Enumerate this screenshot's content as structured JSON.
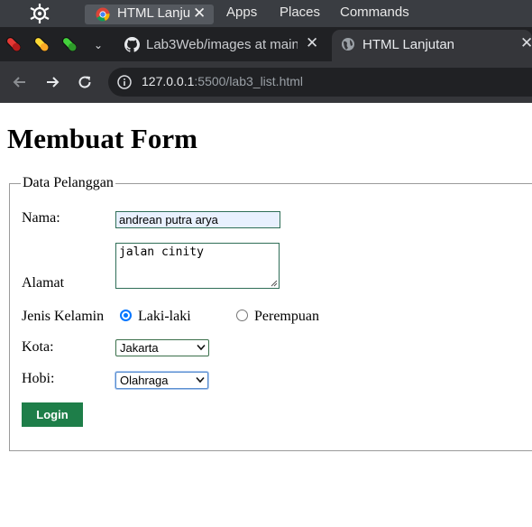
{
  "os_panel": {
    "task_title": "HTML Lanju",
    "menus": [
      "Apps",
      "Places",
      "Commands"
    ]
  },
  "browser": {
    "tabs": [
      {
        "title": "Lab3Web/images at main",
        "icon": "github-icon",
        "active": false
      },
      {
        "title": "HTML Lanjutan",
        "icon": "globe-icon",
        "active": true
      }
    ],
    "url_host": "127.0.0.1",
    "url_rest": ":5500/lab3_list.html"
  },
  "page": {
    "heading": "Membuat Form",
    "fieldset_legend": "Data Pelanggan",
    "form": {
      "nama_label": "Nama:",
      "nama_value": "andrean putra arya",
      "alamat_label": "Alamat",
      "alamat_value": "jalan cinity",
      "gender_label": "Jenis Kelamin",
      "gender_options": [
        "Laki-laki",
        "Perempuan"
      ],
      "gender_selected": "Laki-laki",
      "kota_label": "Kota:",
      "kota_selected": "Jakarta",
      "hobi_label": "Hobi:",
      "hobi_selected": "Olahraga",
      "login_label": "Login"
    }
  },
  "colors": {
    "os_panel": "#3a3d42",
    "tabstrip": "#202124",
    "toolbar": "#35363a",
    "login_button": "#1e7e49",
    "radio_checked": "#0075ff"
  }
}
